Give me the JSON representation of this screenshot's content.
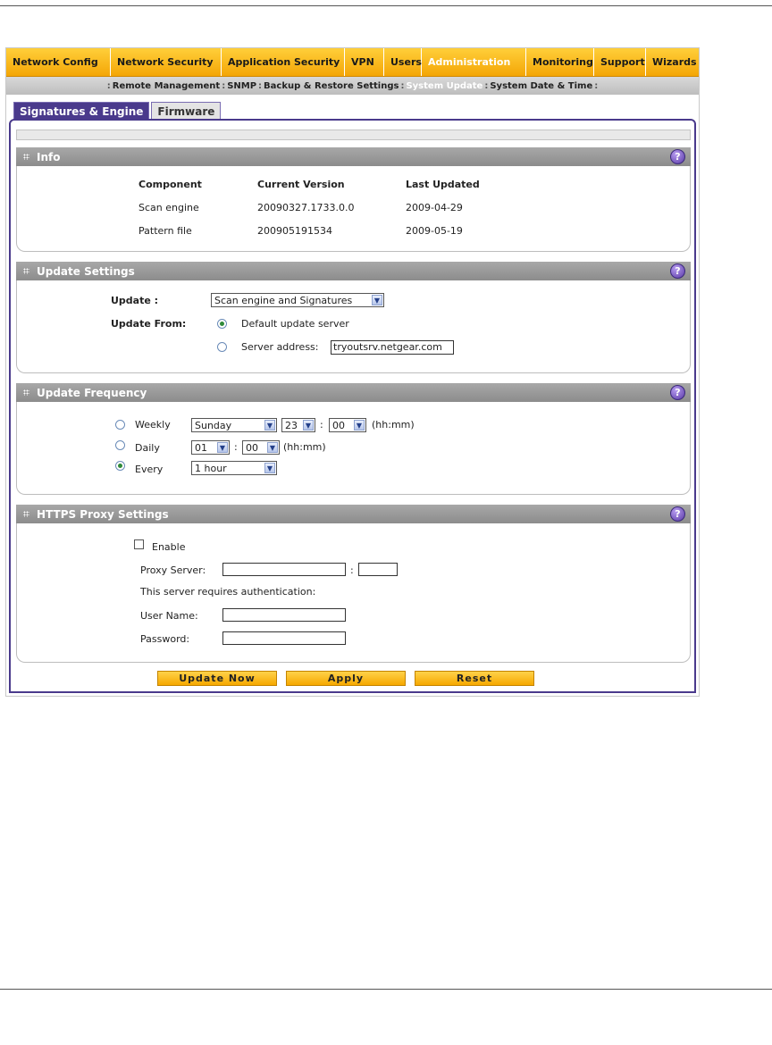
{
  "menu": {
    "items": [
      {
        "label": "Network Config"
      },
      {
        "label": "Network Security"
      },
      {
        "label": "Application Security"
      },
      {
        "label": "VPN"
      },
      {
        "label": "Users"
      },
      {
        "label": "Administration"
      },
      {
        "label": "Monitoring"
      },
      {
        "label": "Support"
      },
      {
        "label": "Wizards"
      }
    ],
    "active": "Administration"
  },
  "submenu": {
    "items": [
      {
        "label": "Remote Management"
      },
      {
        "label": "SNMP"
      },
      {
        "label": "Backup & Restore Settings"
      },
      {
        "label": "System Update"
      },
      {
        "label": "System Date & Time"
      }
    ],
    "separator": ":"
  },
  "tabs": [
    {
      "label": "Signatures & Engine"
    },
    {
      "label": "Firmware"
    }
  ],
  "info": {
    "title": "Info",
    "columns": [
      "Component",
      "Current Version",
      "Last Updated"
    ],
    "rows": [
      [
        "Scan engine",
        "20090327.1733.0.0",
        "2009-04-29"
      ],
      [
        "Pattern file",
        "200905191534",
        "2009-05-19"
      ]
    ]
  },
  "update_settings": {
    "title": "Update Settings",
    "update_label": "Update :",
    "update_value": "Scan engine and Signatures",
    "update_from_label": "Update From:",
    "default_server_label": "Default update server",
    "server_address_label": "Server address:",
    "server_address_value": "tryoutsrv.netgear.com"
  },
  "update_frequency": {
    "title": "Update Frequency",
    "weekly_label": "Weekly",
    "weekly_day": "Sunday",
    "weekly_hour": "23",
    "weekly_minute": "00",
    "time_sep": ":",
    "hhmm": "(hh:mm)",
    "daily_label": "Daily",
    "daily_hour": "01",
    "daily_minute": "00",
    "every_label": "Every",
    "every_value": "1 hour"
  },
  "https_proxy": {
    "title": "HTTPS Proxy Settings",
    "enable_label": "Enable",
    "proxy_server_label": "Proxy Server:",
    "port_sep": ":",
    "auth_note": "This server requires authentication:",
    "user_name_label": "User Name:",
    "password_label": "Password:"
  },
  "help_glyph": "?",
  "arrow_glyph": "▼",
  "buttons": {
    "update_now": "Update Now",
    "apply": "Apply",
    "reset": "Reset"
  }
}
